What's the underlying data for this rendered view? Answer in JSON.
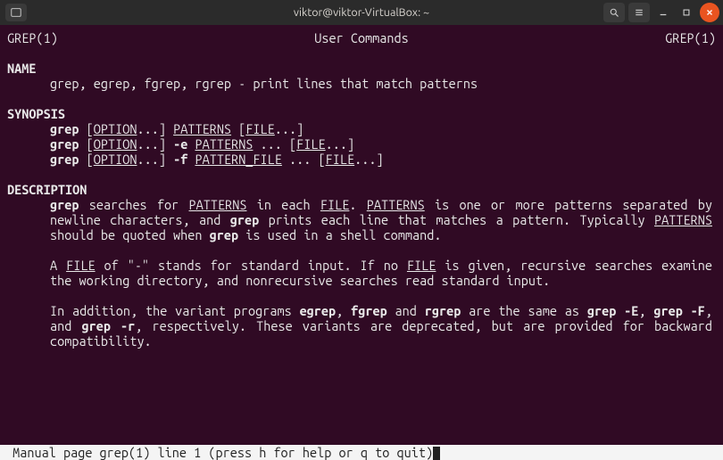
{
  "window": {
    "title": "viktor@viktor-VirtualBox: ~"
  },
  "man": {
    "header_left": "GREP(1)",
    "header_center": "User Commands",
    "header_right": "GREP(1)",
    "name_heading": "NAME",
    "name_line": "grep, egrep, fgrep, rgrep - print lines that match patterns",
    "synopsis_heading": "SYNOPSIS",
    "syn": {
      "grep": "grep",
      "lb": " [",
      "option": "OPTION",
      "dots": "...",
      "rb": "] ",
      "patterns": "PATTERNS",
      "file": "FILE",
      "flag_e": "-e",
      "flag_f": "-f",
      "pattern_file": "PATTERN_FILE",
      "ellipsis": " ... "
    },
    "description_heading": "DESCRIPTION",
    "desc": {
      "p1a": "  searches  for  ",
      "p1b": "  in  each  ",
      "p1c": ".  ",
      "p1d": " is one or more patterns separated by newline characters, and ",
      "p1e": " prints each line that matches a pattern.  Typically ",
      "p1f": " should be quoted when ",
      "p1g": " is used in a shell command.",
      "p2a": "A ",
      "p2b": " of \"-\" stands for standard input.  If no ",
      "p2c": " is given, recursive searches examine the working directory, and nonrecursive searches read standard input.",
      "p3a": "In addition, the variant programs ",
      "egrep": "egrep",
      "comma": ", ",
      "fgrep": "fgrep",
      "and": " and ",
      "rgrep": "rgrep",
      "p3b": " are the same as ",
      "grepE": "grep -E",
      "grepF": "grep -F",
      "and2": ", and ",
      "grepR": "grep -r",
      "p3c": ", respectively.  These variants are deprecated, but are provided for backward compatibility."
    },
    "status": " Manual page grep(1) line 1 (press h for help or q to quit)"
  }
}
